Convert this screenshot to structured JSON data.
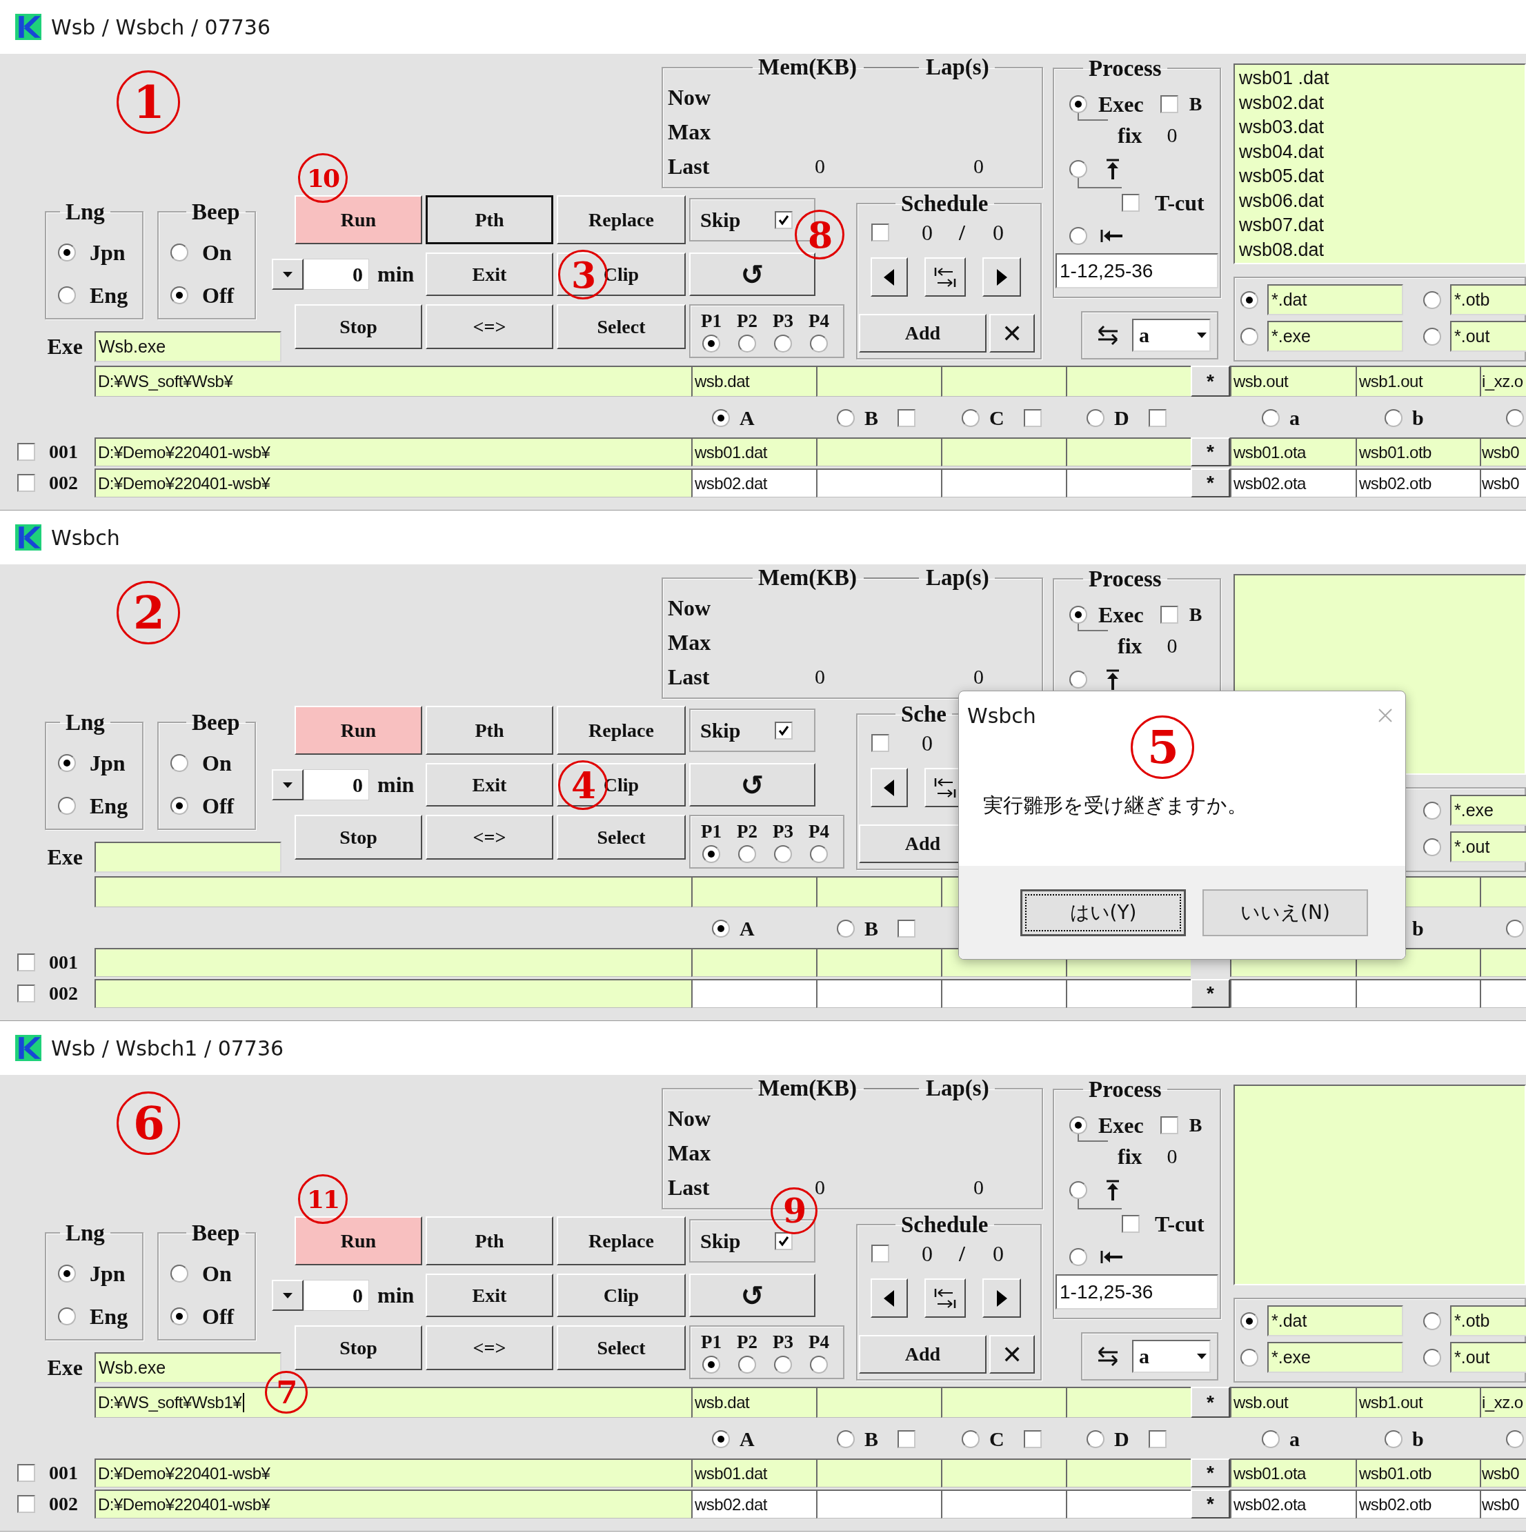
{
  "windows": [
    {
      "title": "Wsb / Wsbch / 07736",
      "annotations": [
        {
          "number": "1",
          "kind": "corner"
        },
        {
          "number": "10",
          "kind": "run"
        },
        {
          "number": "3",
          "kind": "clip"
        },
        {
          "number": "8",
          "kind": "skipside"
        }
      ],
      "lng": {
        "label": "Lng",
        "options": [
          {
            "label": "Jpn",
            "selected": true
          },
          {
            "label": "Eng",
            "selected": false
          }
        ]
      },
      "beep": {
        "label": "Beep",
        "options": [
          {
            "label": "On",
            "selected": false
          },
          {
            "label": "Off",
            "selected": true
          }
        ]
      },
      "exe": {
        "label": "Exe",
        "value": "Wsb.exe"
      },
      "buttons": [
        {
          "label": "Run",
          "kind": "run"
        },
        {
          "label": "Pth",
          "kind": "focused"
        },
        {
          "label": "Replace",
          "kind": "plain"
        },
        {
          "label": "Exit",
          "kind": "plain"
        },
        {
          "label": "Clip",
          "kind": "plain"
        },
        {
          "label": "Stop",
          "kind": "plain"
        },
        {
          "label": "<=>",
          "kind": "plain"
        },
        {
          "label": "Select",
          "kind": "plain"
        }
      ],
      "wait": {
        "value": "0",
        "unit": "min"
      },
      "skip": {
        "label": "Skip",
        "checked": true
      },
      "reload": "↺",
      "priority": [
        {
          "label": "P1",
          "selected": true
        },
        {
          "label": "P2",
          "selected": false
        },
        {
          "label": "P3",
          "selected": false
        },
        {
          "label": "P4",
          "selected": false
        }
      ],
      "mem": {
        "title": "Mem(KB)",
        "lap_title": "Lap(s)",
        "rows": [
          {
            "label": "Now"
          },
          {
            "label": "Max"
          },
          {
            "label": "Last",
            "mem": "0",
            "lap": "0"
          }
        ]
      },
      "schedule": {
        "title": "Schedule",
        "checked": false,
        "count": "0",
        "separator": "/",
        "total": "0",
        "nav": [
          {
            "kind": "prev"
          },
          {
            "kind": "jump"
          },
          {
            "kind": "next"
          }
        ],
        "add": "Add",
        "remove": "✕"
      },
      "process": {
        "title": "Process",
        "exec": {
          "label": "Exec",
          "selected": true
        },
        "b": {
          "label": "B",
          "checked": false
        },
        "fix": {
          "label": "fix",
          "value": "0"
        },
        "top": {
          "selected": false
        },
        "tcut": {
          "label": "T-cut",
          "checked": false
        },
        "back": {
          "selected": false
        },
        "range": "1-12,25-36"
      },
      "swap": {
        "value": "a"
      },
      "files": [
        "wsb01 .dat",
        "wsb02.dat",
        "wsb03.dat",
        "wsb04.dat",
        "wsb05.dat",
        "wsb06.dat",
        "wsb07.dat",
        "wsb08.dat"
      ],
      "filters": {
        "left": [
          {
            "label": "*.dat",
            "selected": true
          },
          {
            "label": "*.exe",
            "selected": false
          }
        ],
        "right": [
          {
            "label": "*.otb",
            "selected": false
          },
          {
            "label": "*.out",
            "selected": false
          }
        ]
      },
      "path_row": {
        "path": "D:¥WS_soft¥Wsb¥",
        "editing": false,
        "inputs": [
          "wsb.dat"
        ],
        "mark": "*",
        "outputs": [
          "wsb.out",
          "wsb1.out",
          "i_xz.o"
        ]
      },
      "radio_row": {
        "inputs": [
          {
            "label": "A",
            "selected": true
          },
          {
            "label": "B",
            "selected": false,
            "checked": false
          },
          {
            "label": "C",
            "selected": false,
            "checked": false
          },
          {
            "label": "D",
            "selected": false,
            "checked": false
          }
        ],
        "outputs": {
          "first": {
            "label": "a",
            "selected": false
          },
          "second": {
            "label": "b",
            "selected": false
          },
          "third": {
            "selected": false
          }
        }
      },
      "rows": [
        {
          "checked": false,
          "number": "001",
          "current": true,
          "path": "D:¥Demo¥220401-wsb¥",
          "inputs": [
            "wsb01.dat"
          ],
          "mark": "*",
          "outputs": [
            "wsb01.ota",
            "wsb01.otb",
            "wsb0"
          ]
        },
        {
          "checked": false,
          "number": "002",
          "current": false,
          "path": "D:¥Demo¥220401-wsb¥",
          "inputs": [
            "wsb02.dat"
          ],
          "mark": "*",
          "outputs": [
            "wsb02.ota",
            "wsb02.otb",
            "wsb0"
          ]
        }
      ]
    },
    {
      "title": "Wsbch",
      "annotations": [
        {
          "number": "2",
          "kind": "corner"
        },
        {
          "number": "4",
          "kind": "clip"
        },
        {
          "number": "5",
          "kind": "dialog"
        }
      ],
      "lng": {
        "label": "Lng",
        "options": [
          {
            "label": "Jpn",
            "selected": true
          },
          {
            "label": "Eng",
            "selected": false
          }
        ]
      },
      "beep": {
        "label": "Beep",
        "options": [
          {
            "label": "On",
            "selected": false
          },
          {
            "label": "Off",
            "selected": true
          }
        ]
      },
      "exe": {
        "label": "Exe"
      },
      "buttons": [
        {
          "label": "Run",
          "kind": "run"
        },
        {
          "label": "Pth",
          "kind": "plain"
        },
        {
          "label": "Replace",
          "kind": "plain"
        },
        {
          "label": "Exit",
          "kind": "plain"
        },
        {
          "label": "Clip",
          "kind": "plain"
        },
        {
          "label": "Stop",
          "kind": "plain"
        },
        {
          "label": "<=>",
          "kind": "plain"
        },
        {
          "label": "Select",
          "kind": "plain"
        }
      ],
      "wait": {
        "value": "0",
        "unit": "min"
      },
      "skip": {
        "label": "Skip",
        "checked": true
      },
      "reload": "↺",
      "priority": [
        {
          "label": "P1",
          "selected": true
        },
        {
          "label": "P2",
          "selected": false
        },
        {
          "label": "P3",
          "selected": false
        },
        {
          "label": "P4",
          "selected": false
        }
      ],
      "mem": {
        "title": "Mem(KB)",
        "lap_title": "Lap(s)",
        "rows": [
          {
            "label": "Now"
          },
          {
            "label": "Max"
          },
          {
            "label": "Last",
            "mem": "0",
            "lap": "0"
          }
        ]
      },
      "schedule": {
        "title": "Sche",
        "checked": false,
        "count": "0",
        "nav": [
          {
            "kind": "prev"
          },
          {
            "kind": "jump"
          }
        ],
        "add": "Add"
      },
      "process": {
        "title": "Process",
        "exec": {
          "label": "Exec",
          "selected": true
        },
        "b": {
          "label": "B",
          "checked": false
        },
        "fix": {
          "label": "fix",
          "value": "0"
        },
        "top": {
          "selected": false
        }
      },
      "filters": {
        "right": [
          {
            "label": "*.exe",
            "selected": false
          },
          {
            "label": "*.out",
            "selected": false
          }
        ]
      },
      "path_row": {
        "editing": false
      },
      "radio_row": {
        "inputs": [
          {
            "label": "A",
            "selected": true
          },
          {
            "label": "B",
            "selected": false,
            "checked": false
          }
        ],
        "outputs": {
          "second": {
            "label": "b"
          },
          "third": {
            "selected": false
          }
        }
      },
      "rows": [
        {
          "checked": false,
          "number": "001",
          "current": true
        },
        {
          "checked": false,
          "number": "002",
          "current": false,
          "mark": "*"
        }
      ],
      "dialog": {
        "title": "Wsbch",
        "message": "実行雛形を受け継ぎますか。",
        "buttons": [
          {
            "label": "はい(Y)",
            "focused": true
          },
          {
            "label": "いいえ(N)",
            "focused": false
          }
        ]
      }
    },
    {
      "title": "Wsb / Wsbch1 / 07736",
      "annotations": [
        {
          "number": "6",
          "kind": "corner"
        },
        {
          "number": "11",
          "kind": "run"
        },
        {
          "number": "9",
          "kind": "skiptop"
        },
        {
          "number": "7",
          "kind": "path"
        }
      ],
      "lng": {
        "label": "Lng",
        "options": [
          {
            "label": "Jpn",
            "selected": true
          },
          {
            "label": "Eng",
            "selected": false
          }
        ]
      },
      "beep": {
        "label": "Beep",
        "options": [
          {
            "label": "On",
            "selected": false
          },
          {
            "label": "Off",
            "selected": true
          }
        ]
      },
      "exe": {
        "label": "Exe",
        "value": "Wsb.exe"
      },
      "buttons": [
        {
          "label": "Run",
          "kind": "run"
        },
        {
          "label": "Pth",
          "kind": "plain"
        },
        {
          "label": "Replace",
          "kind": "plain"
        },
        {
          "label": "Exit",
          "kind": "plain"
        },
        {
          "label": "Clip",
          "kind": "plain"
        },
        {
          "label": "Stop",
          "kind": "plain"
        },
        {
          "label": "<=>",
          "kind": "plain"
        },
        {
          "label": "Select",
          "kind": "plain"
        }
      ],
      "wait": {
        "value": "0",
        "unit": "min"
      },
      "skip": {
        "label": "Skip",
        "checked": true
      },
      "reload": "↺",
      "priority": [
        {
          "label": "P1",
          "selected": true
        },
        {
          "label": "P2",
          "selected": false
        },
        {
          "label": "P3",
          "selected": false
        },
        {
          "label": "P4",
          "selected": false
        }
      ],
      "mem": {
        "title": "Mem(KB)",
        "lap_title": "Lap(s)",
        "rows": [
          {
            "label": "Now"
          },
          {
            "label": "Max"
          },
          {
            "label": "Last",
            "mem": "0",
            "lap": "0"
          }
        ]
      },
      "schedule": {
        "title": "Schedule",
        "checked": false,
        "count": "0",
        "separator": "/",
        "total": "0",
        "nav": [
          {
            "kind": "prev"
          },
          {
            "kind": "jump"
          },
          {
            "kind": "next"
          }
        ],
        "add": "Add",
        "remove": "✕"
      },
      "process": {
        "title": "Process",
        "exec": {
          "label": "Exec",
          "selected": true
        },
        "b": {
          "label": "B",
          "checked": false
        },
        "fix": {
          "label": "fix",
          "value": "0"
        },
        "top": {
          "selected": false
        },
        "tcut": {
          "label": "T-cut",
          "checked": false
        },
        "back": {
          "selected": false
        },
        "range": "1-12,25-36"
      },
      "swap": {
        "value": "a"
      },
      "filters": {
        "left": [
          {
            "label": "*.dat",
            "selected": true
          },
          {
            "label": "*.exe",
            "selected": false
          }
        ],
        "right": [
          {
            "label": "*.otb",
            "selected": false
          },
          {
            "label": "*.out",
            "selected": false
          }
        ]
      },
      "path_row": {
        "path": "D:¥WS_soft¥Wsb1¥",
        "editing": true,
        "inputs": [
          "wsb.dat"
        ],
        "mark": "*",
        "outputs": [
          "wsb.out",
          "wsb1.out",
          "i_xz.o"
        ]
      },
      "radio_row": {
        "inputs": [
          {
            "label": "A",
            "selected": true
          },
          {
            "label": "B",
            "selected": false,
            "checked": false
          },
          {
            "label": "C",
            "selected": false,
            "checked": false
          },
          {
            "label": "D",
            "selected": false,
            "checked": false
          }
        ],
        "outputs": {
          "first": {
            "label": "a",
            "selected": false
          },
          "second": {
            "label": "b",
            "selected": false
          },
          "third": {
            "selected": false
          }
        }
      },
      "rows": [
        {
          "checked": false,
          "number": "001",
          "current": true,
          "path": "D:¥Demo¥220401-wsb¥",
          "inputs": [
            "wsb01.dat"
          ],
          "mark": "*",
          "outputs": [
            "wsb01.ota",
            "wsb01.otb",
            "wsb0"
          ]
        },
        {
          "checked": false,
          "number": "002",
          "current": false,
          "path": "D:¥Demo¥220401-wsb¥",
          "inputs": [
            "wsb02.dat"
          ],
          "mark": "*",
          "outputs": [
            "wsb02.ota",
            "wsb02.otb",
            "wsb0"
          ]
        }
      ]
    }
  ]
}
